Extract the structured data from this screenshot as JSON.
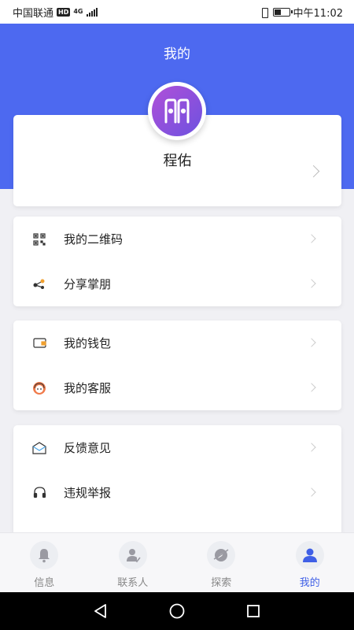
{
  "status_bar": {
    "carrier": "中国联通",
    "hd": "HD",
    "network": "4G",
    "time": "中午11:02"
  },
  "header": {
    "title": "我的"
  },
  "profile": {
    "name": "程佑"
  },
  "menu_groups": [
    [
      {
        "label": "我的二维码",
        "icon": "qr-code-icon"
      },
      {
        "label": "分享掌朋",
        "icon": "share-icon"
      }
    ],
    [
      {
        "label": "我的钱包",
        "icon": "wallet-icon"
      },
      {
        "label": "我的客服",
        "icon": "customer-service-icon"
      }
    ],
    [
      {
        "label": "反馈意见",
        "icon": "mail-icon"
      },
      {
        "label": "违规举报",
        "icon": "headset-icon"
      }
    ]
  ],
  "tabs": [
    {
      "label": "信息",
      "icon": "bell-icon",
      "active": false
    },
    {
      "label": "联系人",
      "icon": "contacts-icon",
      "active": false
    },
    {
      "label": "探索",
      "icon": "compass-icon",
      "active": false
    },
    {
      "label": "我的",
      "icon": "person-icon",
      "active": true
    }
  ],
  "colors": {
    "accent": "#4d69f0",
    "tab_active": "#3f5fe6",
    "avatar_gradient_start": "#b04fd8",
    "avatar_gradient_end": "#6d52e0"
  }
}
